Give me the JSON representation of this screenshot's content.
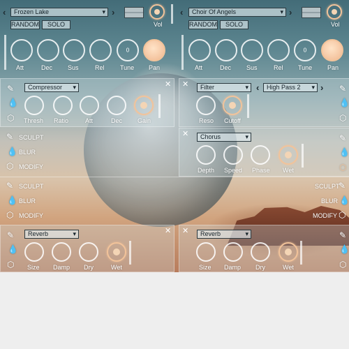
{
  "layers": [
    {
      "preset": "Frozen Lake",
      "random_label": "RANDOM",
      "solo_label": "SOLO",
      "vol_label": "Vol",
      "knobs": [
        "Att",
        "Dec",
        "Sus",
        "Rel",
        "Tune",
        "Pan"
      ],
      "tune_value": "0"
    },
    {
      "preset": "Choir Of Angels",
      "random_label": "RANDOM",
      "solo_label": "SOLO",
      "vol_label": "Vol",
      "knobs": [
        "Att",
        "Dec",
        "Sus",
        "Rel",
        "Tune",
        "Pan"
      ],
      "tune_value": "0"
    }
  ],
  "fx": {
    "compressor": {
      "type": "Compressor",
      "knobs": [
        "Thresh",
        "Ratio",
        "Att",
        "Dec",
        "Gain"
      ]
    },
    "filter": {
      "type": "Filter",
      "mode": "High Pass 2",
      "knobs": [
        "Reso",
        "Cutoff"
      ]
    },
    "chorus": {
      "type": "Chorus",
      "knobs": [
        "Depth",
        "Speed",
        "Phase",
        "Wet"
      ]
    },
    "reverb_left": {
      "type": "Reverb",
      "knobs": [
        "Size",
        "Damp",
        "Dry",
        "Wet"
      ]
    },
    "reverb_right": {
      "type": "Reverb",
      "knobs": [
        "Size",
        "Damp",
        "Dry",
        "Wet"
      ]
    }
  },
  "side_labels": {
    "sculpt": "SCULPT",
    "blur": "BLUR",
    "modify": "MODIFY"
  },
  "icons": [
    "pencil-icon",
    "drop-icon",
    "hexagon-icon",
    "close-icon",
    "chevron-left-icon",
    "chevron-right-icon"
  ],
  "colors": {
    "accent": "#f2c39a",
    "panel": "#cddce1"
  }
}
